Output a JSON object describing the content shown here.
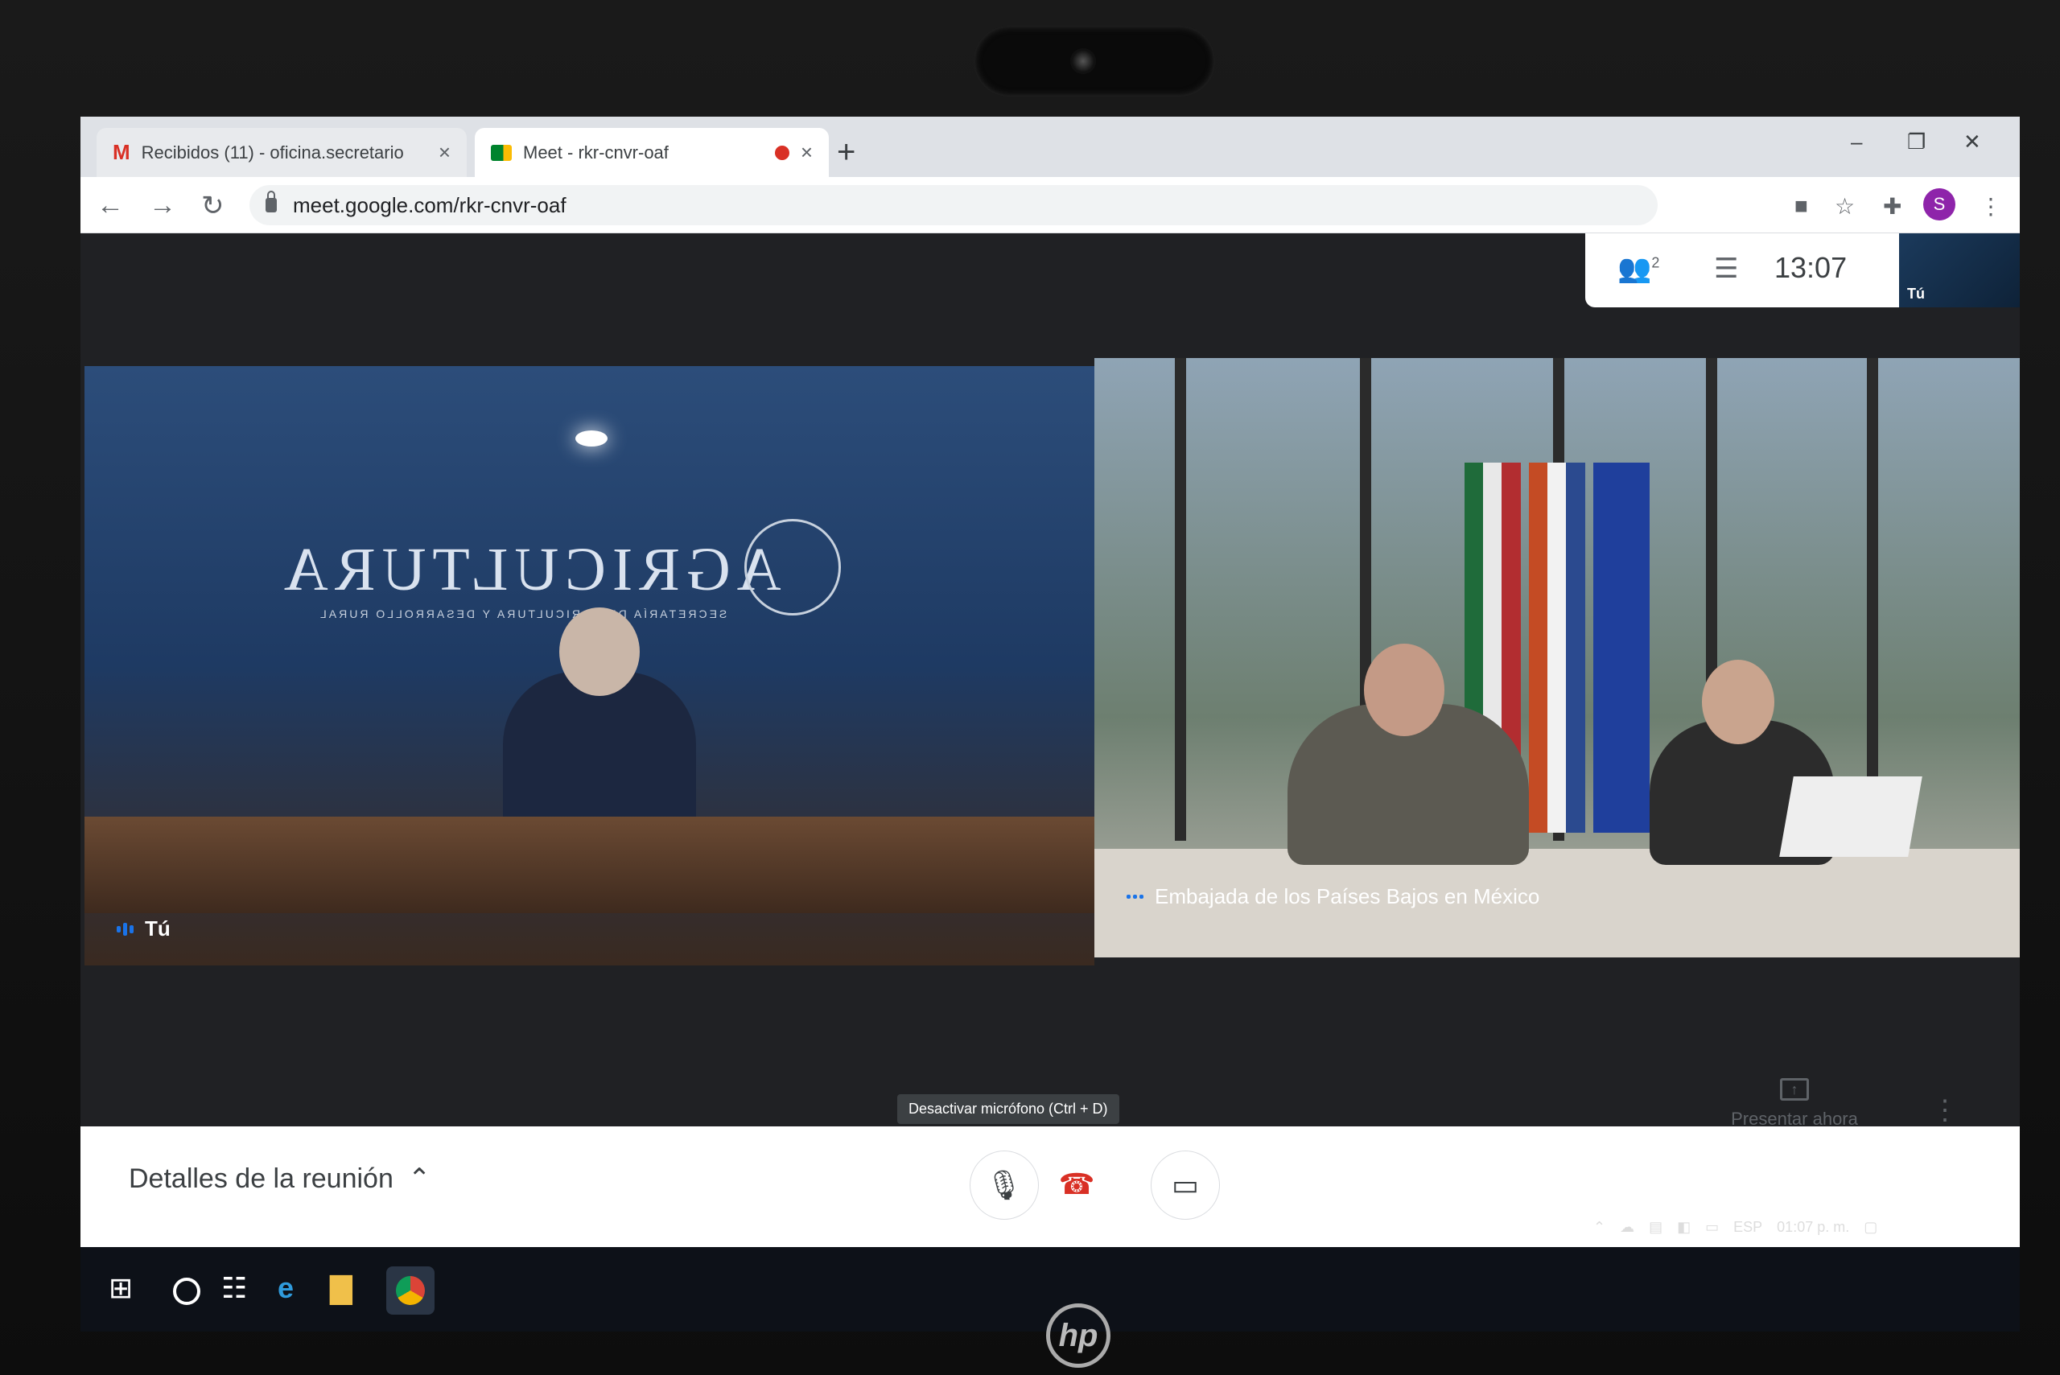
{
  "browser": {
    "tabs": [
      {
        "label": "Recibidos (11) - oficina.secretario",
        "icon": "gmail-icon",
        "close": "×"
      },
      {
        "label": "Meet - rkr-cnvr-oaf",
        "icon": "meet-icon",
        "close": "×",
        "recording_indicator": "red-dot"
      }
    ],
    "new_tab_label": "+",
    "window_controls": {
      "minimize": "–",
      "restore": "❐",
      "close": "✕"
    },
    "url": "meet.google.com/rkr-cnvr-oaf",
    "profile_initial": "S"
  },
  "meet": {
    "participants_count": "2",
    "time": "13:07",
    "self_thumbnail_label": "Tú",
    "tiles": [
      {
        "name": "Tú",
        "sign_text": "AGRICULTURA",
        "sign_subtitle": "SECRETARÍA DE AGRICULTURA Y DESARROLLO RURAL"
      },
      {
        "name": "Embajada de los Países Bajos en México"
      }
    ],
    "present_now_label": "Presentar ahora",
    "meeting_details_label": "Detalles de la reunión",
    "mic_tooltip": "Desactivar micrófono (Ctrl + D)"
  },
  "taskbar": {
    "tray_language": "ESP",
    "tray_time": "01:07 p. m."
  },
  "colors": {
    "accent_blue": "#1a73e8",
    "hangup_red": "#d93025",
    "recording_red": "#d93025"
  }
}
